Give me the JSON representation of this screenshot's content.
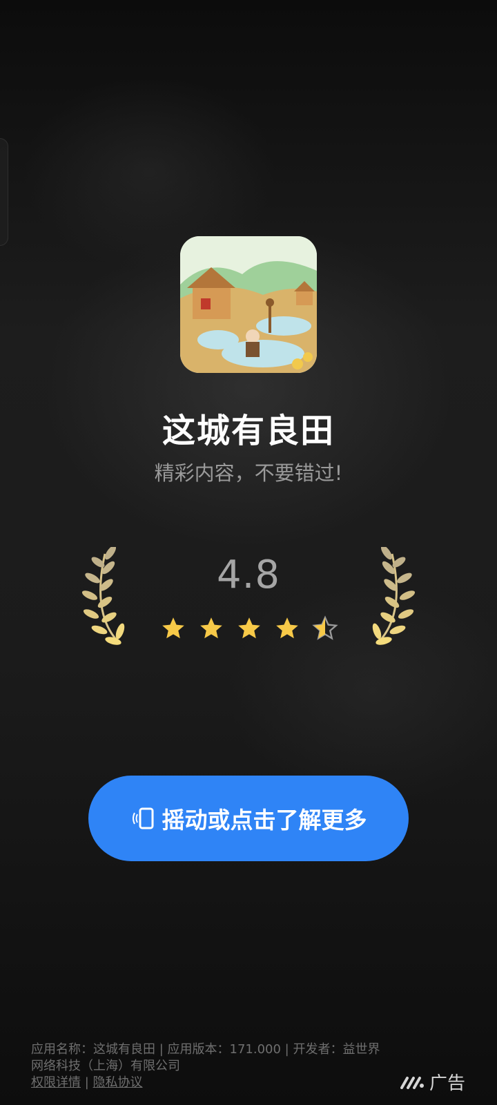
{
  "app": {
    "name": "这城有良田",
    "tagline": "精彩内容，不要错过!",
    "rating": "4.8",
    "rating_value": 4.8,
    "rating_max": 5
  },
  "cta": {
    "label": "摇动或点击了解更多",
    "color": "#2f84f6"
  },
  "footer": {
    "info_line": "应用名称：这城有良田 | 应用版本：171.000 | 开发者：益世界网络科技（上海）有限公司",
    "permissions_label": "权限详情",
    "separator": "|",
    "privacy_label": "隐私协议"
  },
  "ad": {
    "label": "广告",
    "logo_icon": "ad-network-logo-icon"
  },
  "colors": {
    "star": "#f7c948",
    "laurel": "#d8c48a"
  }
}
